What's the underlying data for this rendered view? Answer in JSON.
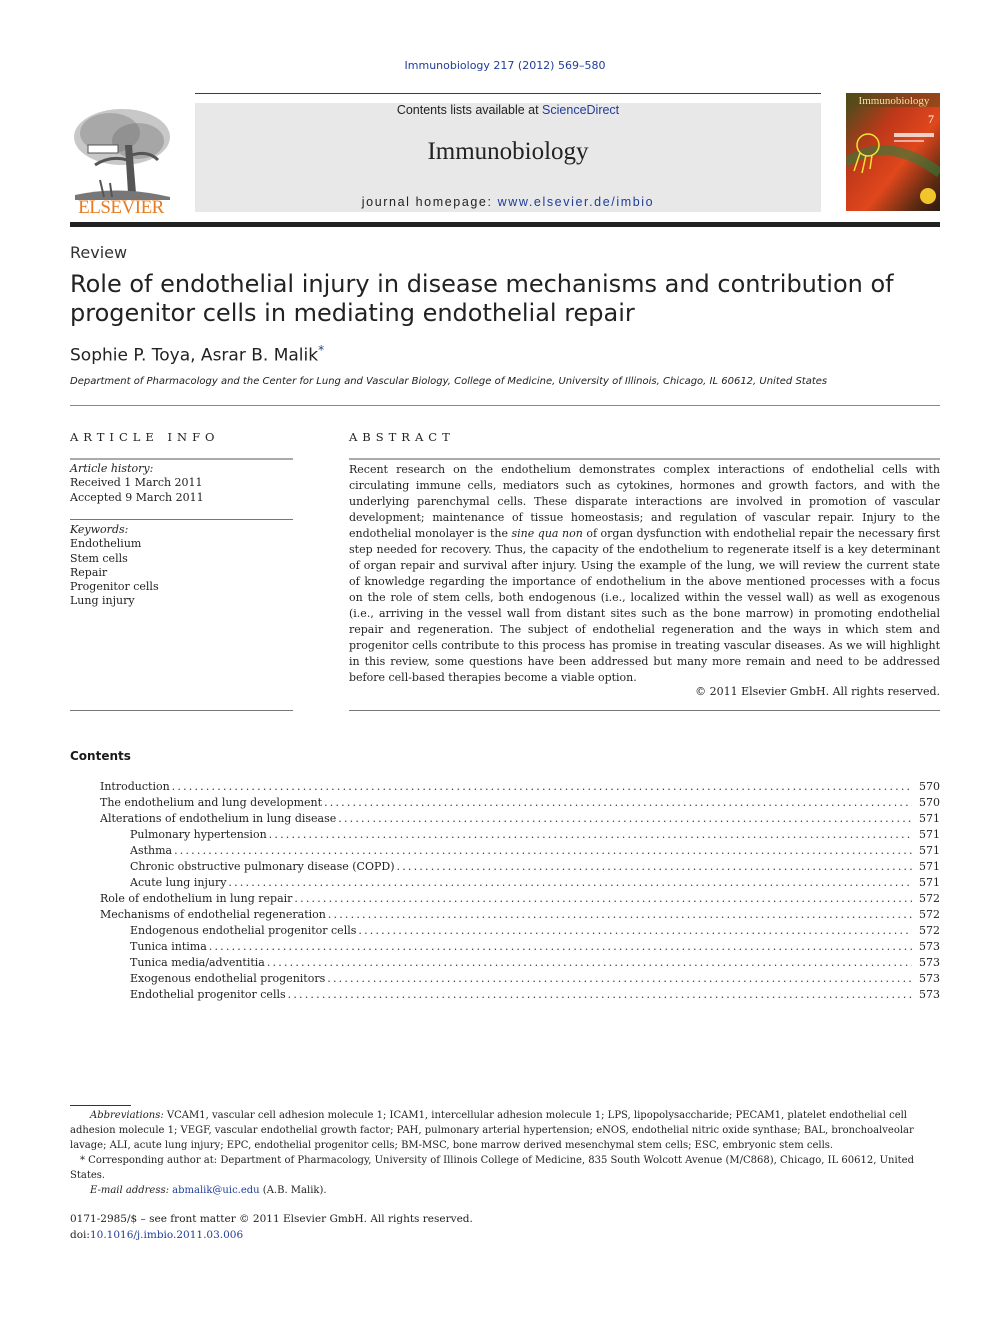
{
  "header": {
    "citation": "Immunobiology 217 (2012) 569–580",
    "contents_prefix": "Contents lists available at ",
    "sciencedirect_link": "ScienceDirect",
    "journal_name": "Immunobiology",
    "homepage_prefix": "journal homepage: ",
    "homepage_link": "www.elsevier.de/imbio",
    "publisher_logo_text": "ELSEVIER",
    "cover_title": "Immunobiology",
    "cover_issue_number": "7"
  },
  "article": {
    "type": "Review",
    "title": "Role of endothelial injury in disease mechanisms and contribution of progenitor cells in mediating endothelial repair",
    "authors": "Sophie P. Toya, Asrar B. Malik",
    "author_mark": "*",
    "affiliation": "Department of Pharmacology and the Center for Lung and Vascular Biology, College of Medicine, University of Illinois, Chicago, IL 60612, United States"
  },
  "article_info": {
    "heading": "ARTICLE INFO",
    "history_label": "Article history:",
    "received": "Received 1 March 2011",
    "accepted": "Accepted 9 March 2011",
    "keywords_label": "Keywords:",
    "keywords": [
      "Endothelium",
      "Stem cells",
      "Repair",
      "Progenitor cells",
      "Lung injury"
    ]
  },
  "abstract": {
    "heading": "ABSTRACT",
    "part1": "Recent research on the endothelium demonstrates complex interactions of endothelial cells with circulating immune cells, mediators such as cytokines, hormones and growth factors, and with the underlying parenchymal cells. These disparate interactions are involved in promotion of vascular development; maintenance of tissue homeostasis; and regulation of vascular repair. Injury to the endothelial monolayer is the ",
    "italic": "sine qua non",
    "part2": " of organ dysfunction with endothelial repair the necessary first step needed for recovery. Thus, the capacity of the endothelium to regenerate itself is a key determinant of organ repair and survival after injury. Using the example of the lung, we will review the current state of knowledge regarding the importance of endothelium in the above mentioned processes with a focus on the role of stem cells, both endogenous (i.e., localized within the vessel wall) as well as exogenous (i.e., arriving in the vessel wall from distant sites such as the bone marrow) in promoting endothelial repair and regeneration. The subject of endothelial regeneration and the ways in which stem and progenitor cells contribute to this process has promise in treating vascular diseases. As we will highlight in this review, some questions have been addressed but many more remain and need to be addressed before cell-based therapies become a viable option.",
    "copyright": "© 2011 Elsevier GmbH. All rights reserved."
  },
  "contents": {
    "heading": "Contents",
    "items": [
      {
        "title": "Introduction",
        "page": "570",
        "level": 1
      },
      {
        "title": "The endothelium and lung development",
        "page": "570",
        "level": 1
      },
      {
        "title": "Alterations of endothelium in lung disease",
        "page": "571",
        "level": 1
      },
      {
        "title": "Pulmonary hypertension",
        "page": "571",
        "level": 2
      },
      {
        "title": "Asthma",
        "page": "571",
        "level": 2
      },
      {
        "title": "Chronic obstructive pulmonary disease (COPD)",
        "page": "571",
        "level": 2
      },
      {
        "title": "Acute lung injury",
        "page": "571",
        "level": 2
      },
      {
        "title": "Role of endothelium in lung repair",
        "page": "572",
        "level": 1
      },
      {
        "title": "Mechanisms of endothelial regeneration",
        "page": "572",
        "level": 1
      },
      {
        "title": "Endogenous endothelial progenitor cells",
        "page": "572",
        "level": 2
      },
      {
        "title": "Tunica intima",
        "page": "573",
        "level": 2
      },
      {
        "title": "Tunica media/adventitia",
        "page": "573",
        "level": 2
      },
      {
        "title": "Exogenous endothelial progenitors",
        "page": "573",
        "level": 2
      },
      {
        "title": "Endothelial progenitor cells",
        "page": "573",
        "level": 2
      }
    ]
  },
  "footnotes": {
    "abbrev_label": "Abbreviations:",
    "abbrev_text": " VCAM1, vascular cell adhesion molecule 1; ICAM1, intercellular adhesion molecule 1; LPS, lipopolysaccharide; PECAM1, platelet endothelial cell adhesion molecule 1; VEGF, vascular endothelial growth factor; PAH, pulmonary arterial hypertension; eNOS, endothelial nitric oxide synthase; BAL, bronchoalveolar lavage; ALI, acute lung injury; EPC, endothelial progenitor cells; BM-MSC, bone marrow derived mesenchymal stem cells; ESC, embryonic stem cells.",
    "corresponding": "* Corresponding author at: Department of Pharmacology, University of Illinois College of Medicine, 835 South Wolcott Avenue (M/C868), Chicago, IL 60612, United States.",
    "email_label": "E-mail address:",
    "email": "abmalik@uic.edu",
    "email_suffix": " (A.B. Malik)."
  },
  "bottom": {
    "issn_line": "0171-2985/$ – see front matter © 2011 Elsevier GmbH. All rights reserved.",
    "doi_prefix": "doi:",
    "doi_link": "10.1016/j.imbio.2011.03.006"
  },
  "colors": {
    "link": "#1f3d99",
    "elsevier_orange": "#e87a1f",
    "banner_gray": "#e8e8e8"
  }
}
